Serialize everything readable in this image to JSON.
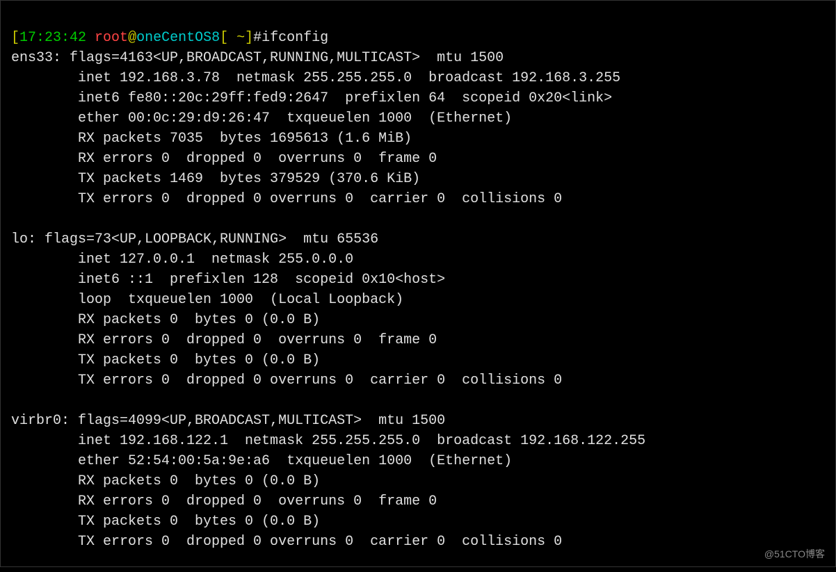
{
  "prompt": {
    "bracket_open": "[",
    "time": "17:23:42",
    "space1": " ",
    "user": "root",
    "at": "@",
    "host": "oneCentOS8",
    "bracket_path": "[ ~]",
    "hash": "#",
    "command": "ifconfig"
  },
  "output_lines": [
    "ens33: flags=4163<UP,BROADCAST,RUNNING,MULTICAST>  mtu 1500",
    "        inet 192.168.3.78  netmask 255.255.255.0  broadcast 192.168.3.255",
    "        inet6 fe80::20c:29ff:fed9:2647  prefixlen 64  scopeid 0x20<link>",
    "        ether 00:0c:29:d9:26:47  txqueuelen 1000  (Ethernet)",
    "        RX packets 7035  bytes 1695613 (1.6 MiB)",
    "        RX errors 0  dropped 0  overruns 0  frame 0",
    "        TX packets 1469  bytes 379529 (370.6 KiB)",
    "        TX errors 0  dropped 0 overruns 0  carrier 0  collisions 0",
    "",
    "lo: flags=73<UP,LOOPBACK,RUNNING>  mtu 65536",
    "        inet 127.0.0.1  netmask 255.0.0.0",
    "        inet6 ::1  prefixlen 128  scopeid 0x10<host>",
    "        loop  txqueuelen 1000  (Local Loopback)",
    "        RX packets 0  bytes 0 (0.0 B)",
    "        RX errors 0  dropped 0  overruns 0  frame 0",
    "        TX packets 0  bytes 0 (0.0 B)",
    "        TX errors 0  dropped 0 overruns 0  carrier 0  collisions 0",
    "",
    "virbr0: flags=4099<UP,BROADCAST,MULTICAST>  mtu 1500",
    "        inet 192.168.122.1  netmask 255.255.255.0  broadcast 192.168.122.255",
    "        ether 52:54:00:5a:9e:a6  txqueuelen 1000  (Ethernet)",
    "        RX packets 0  bytes 0 (0.0 B)",
    "        RX errors 0  dropped 0  overruns 0  frame 0",
    "        TX packets 0  bytes 0 (0.0 B)",
    "        TX errors 0  dropped 0 overruns 0  carrier 0  collisions 0"
  ],
  "watermark": "@51CTO博客"
}
